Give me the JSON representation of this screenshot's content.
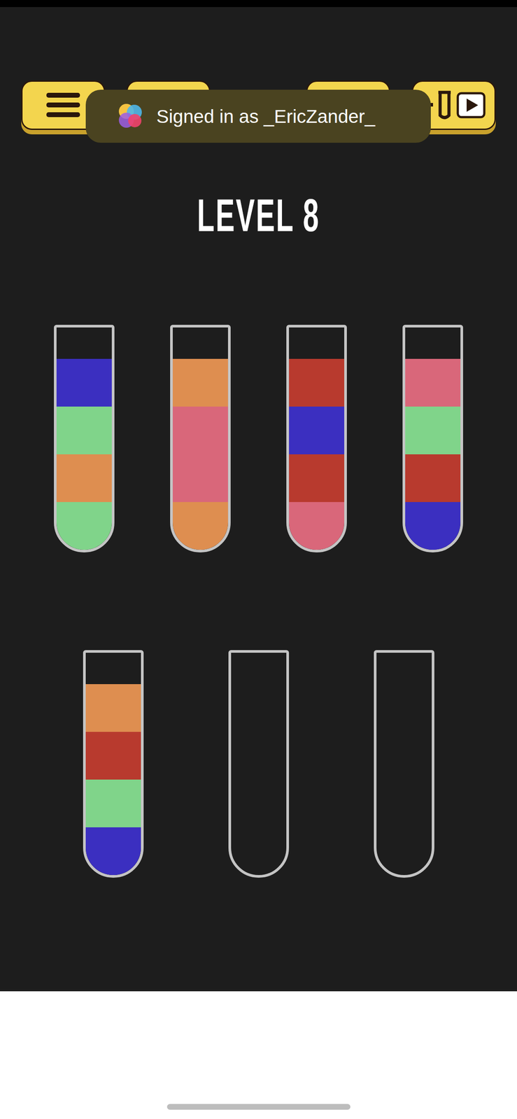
{
  "toast": {
    "text": "Signed in as _EricZander_"
  },
  "level": {
    "title": "LEVEL 8"
  },
  "rows": [
    [
      {
        "segments": [
          "#3b2fc0",
          "#80d48a",
          "#de8e50",
          "#80d48a"
        ]
      },
      {
        "segments": [
          "#de8e50",
          "#d9677a",
          "#d9677a",
          "#de8e50"
        ]
      },
      {
        "segments": [
          "#b83a2e",
          "#3b2fc0",
          "#b83a2e",
          "#d9677a"
        ]
      },
      {
        "segments": [
          "#d9677a",
          "#80d48a",
          "#b83a2e",
          "#3b2fc0"
        ]
      }
    ],
    [
      {
        "segments": [
          "#de8e50",
          "#b83a2e",
          "#80d48a",
          "#3b2fc0"
        ]
      },
      {
        "segments": []
      },
      {
        "segments": []
      }
    ]
  ]
}
